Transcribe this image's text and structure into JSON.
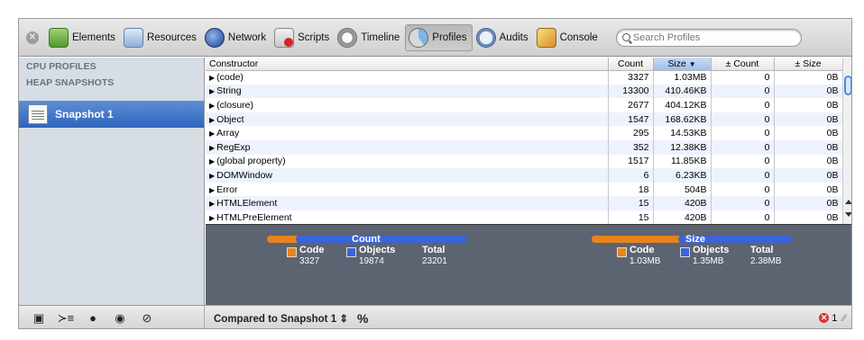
{
  "toolbar": {
    "items": [
      {
        "label": "Elements",
        "icon": "elements-icon",
        "active": false
      },
      {
        "label": "Resources",
        "icon": "resources-icon",
        "active": false
      },
      {
        "label": "Network",
        "icon": "network-icon",
        "active": false
      },
      {
        "label": "Scripts",
        "icon": "scripts-icon",
        "active": false
      },
      {
        "label": "Timeline",
        "icon": "timeline-icon",
        "active": false
      },
      {
        "label": "Profiles",
        "icon": "profiles-icon",
        "active": true
      },
      {
        "label": "Audits",
        "icon": "audits-icon",
        "active": false
      },
      {
        "label": "Console",
        "icon": "console-icon",
        "active": false
      }
    ],
    "search_placeholder": "Search Profiles"
  },
  "sidebar": {
    "cpu_header": "CPU PROFILES",
    "heap_header": "HEAP SNAPSHOTS",
    "selected_item": "Snapshot 1"
  },
  "table": {
    "columns": [
      "Constructor",
      "Count",
      "Size",
      "± Count",
      "± Size"
    ],
    "sorted_column": "Size",
    "rows": [
      {
        "constructor": "(code)",
        "count": "3327",
        "size": "1.03MB",
        "dcount": "0",
        "dsize": "0B"
      },
      {
        "constructor": "String",
        "count": "13300",
        "size": "410.46KB",
        "dcount": "0",
        "dsize": "0B"
      },
      {
        "constructor": "(closure)",
        "count": "2677",
        "size": "404.12KB",
        "dcount": "0",
        "dsize": "0B"
      },
      {
        "constructor": "Object",
        "count": "1547",
        "size": "168.62KB",
        "dcount": "0",
        "dsize": "0B"
      },
      {
        "constructor": "Array",
        "count": "295",
        "size": "14.53KB",
        "dcount": "0",
        "dsize": "0B"
      },
      {
        "constructor": "RegExp",
        "count": "352",
        "size": "12.38KB",
        "dcount": "0",
        "dsize": "0B"
      },
      {
        "constructor": "(global property)",
        "count": "1517",
        "size": "11.85KB",
        "dcount": "0",
        "dsize": "0B"
      },
      {
        "constructor": "DOMWindow",
        "count": "6",
        "size": "6.23KB",
        "dcount": "0",
        "dsize": "0B"
      },
      {
        "constructor": "Error",
        "count": "18",
        "size": "504B",
        "dcount": "0",
        "dsize": "0B"
      },
      {
        "constructor": "HTMLElement",
        "count": "15",
        "size": "420B",
        "dcount": "0",
        "dsize": "0B"
      },
      {
        "constructor": "HTMLPreElement",
        "count": "15",
        "size": "420B",
        "dcount": "0",
        "dsize": "0B"
      }
    ]
  },
  "summary": {
    "count": {
      "title": "Count",
      "code_label": "Code",
      "code_value": "3327",
      "objects_label": "Objects",
      "objects_value": "19874",
      "total_label": "Total",
      "total_value": "23201",
      "code_fraction": 0.143
    },
    "size": {
      "title": "Size",
      "code_label": "Code",
      "code_value": "1.03MB",
      "objects_label": "Objects",
      "objects_value": "1.35MB",
      "total_label": "Total",
      "total_value": "2.38MB",
      "code_fraction": 0.433
    },
    "colors": {
      "code": "#e8841c",
      "objects": "#3a64d8"
    }
  },
  "bottombar": {
    "compare_label": "Compared to Snapshot 1",
    "percent_label": "%",
    "error_count": "1"
  }
}
